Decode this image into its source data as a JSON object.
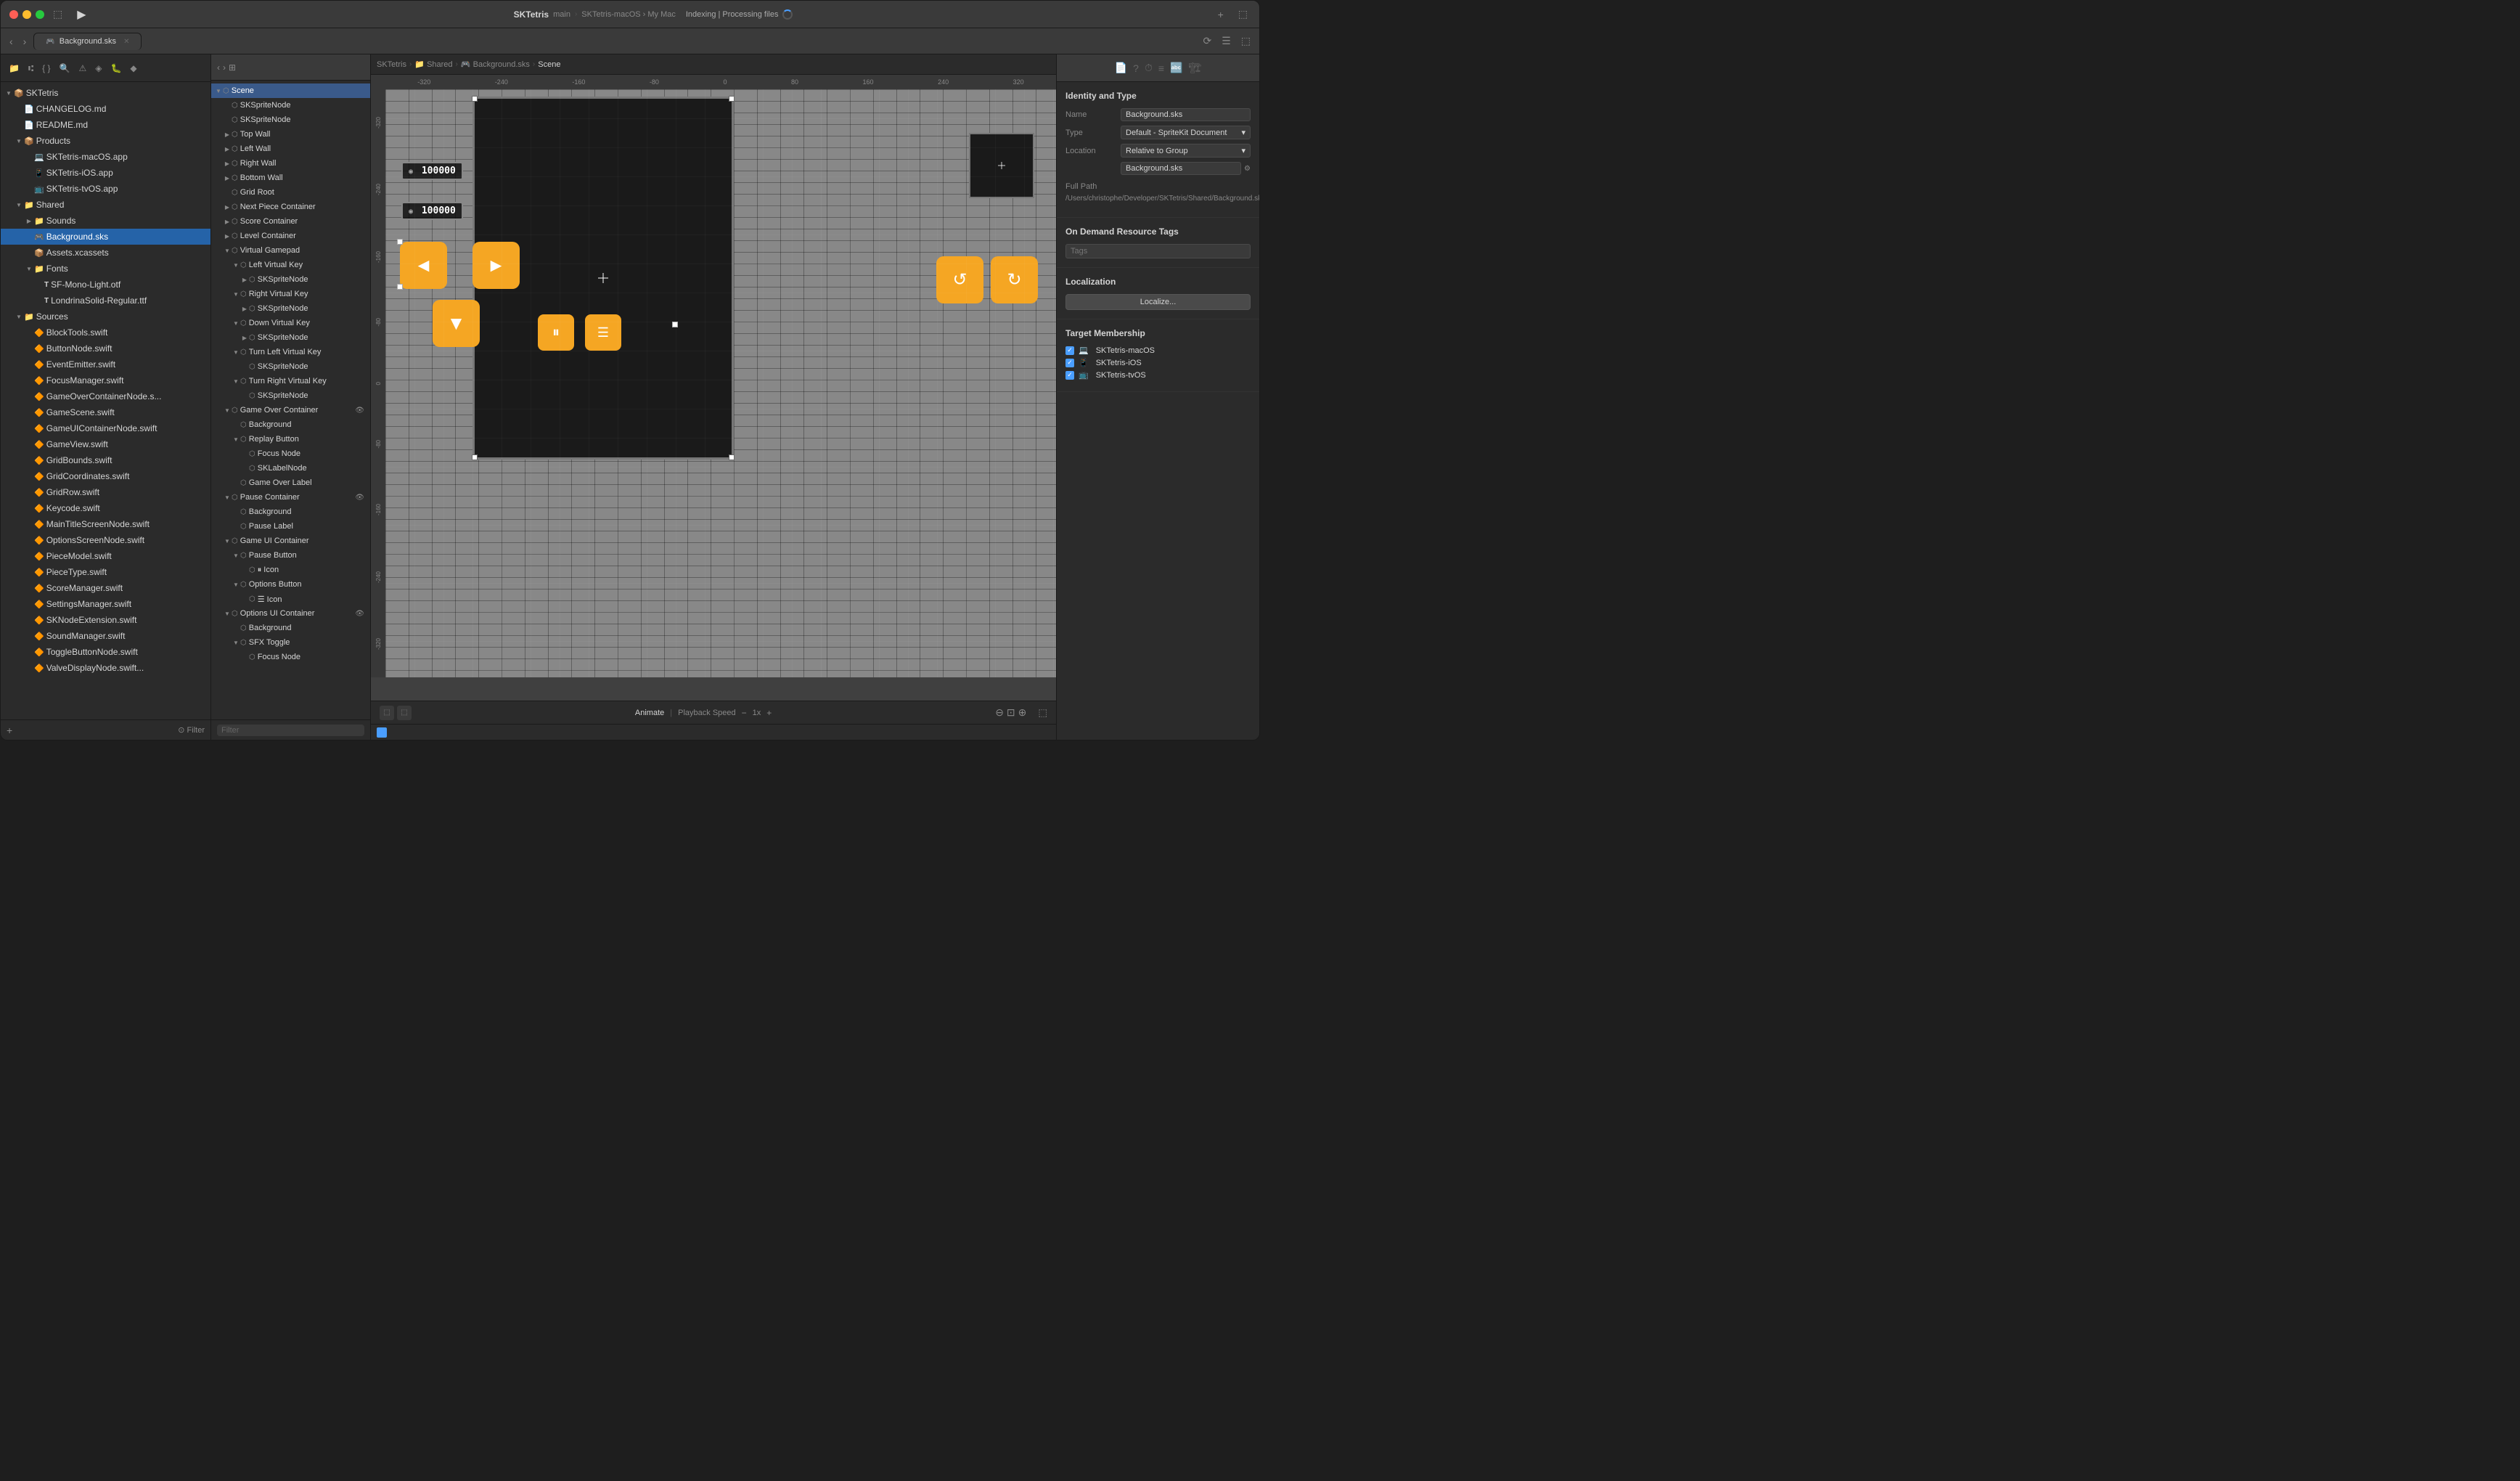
{
  "window": {
    "title": "SKTetris",
    "branch": "main"
  },
  "titleBar": {
    "runBtn": "▶",
    "schemeLabel": "SKTetris",
    "destinationLabel": "SKTetris-macOS › My Mac",
    "statusText": "Indexing | Processing files",
    "sidebarToggle": "⬜",
    "addBtn": "+"
  },
  "tab": {
    "label": "Background.sks",
    "icon": "🎮"
  },
  "breadcrumb": {
    "items": [
      "SKTetris",
      "Shared",
      "Background.sks",
      "Scene"
    ]
  },
  "fileTree": {
    "root": "SKTetris",
    "items": [
      {
        "id": "changelog",
        "label": "CHANGELOG.md",
        "indent": 1,
        "icon": "📄",
        "type": "file"
      },
      {
        "id": "readme",
        "label": "README.md",
        "indent": 1,
        "icon": "📄",
        "type": "file"
      },
      {
        "id": "products",
        "label": "Products",
        "indent": 1,
        "icon": "📦",
        "type": "group",
        "expanded": true
      },
      {
        "id": "app-macos",
        "label": "SKTetris-macOS.app",
        "indent": 2,
        "icon": "💻",
        "type": "file"
      },
      {
        "id": "app-ios",
        "label": "SKTetris-iOS.app",
        "indent": 2,
        "icon": "📱",
        "type": "file"
      },
      {
        "id": "app-tvos",
        "label": "SKTetris-tvOS.app",
        "indent": 2,
        "icon": "📺",
        "type": "file"
      },
      {
        "id": "shared",
        "label": "Shared",
        "indent": 1,
        "icon": "📁",
        "type": "group",
        "expanded": true
      },
      {
        "id": "sounds",
        "label": "Sounds",
        "indent": 2,
        "icon": "📁",
        "type": "group",
        "expanded": false
      },
      {
        "id": "background-sks",
        "label": "Background.sks",
        "indent": 2,
        "icon": "🎮",
        "type": "file",
        "selected": true
      },
      {
        "id": "assets",
        "label": "Assets.xcassets",
        "indent": 2,
        "icon": "📦",
        "type": "file"
      },
      {
        "id": "fonts",
        "label": "Fonts",
        "indent": 2,
        "icon": "📁",
        "type": "group",
        "expanded": true
      },
      {
        "id": "sf-mono",
        "label": "SF-Mono-Light.otf",
        "indent": 3,
        "icon": "T",
        "type": "file"
      },
      {
        "id": "londrina",
        "label": "LondrinaSolid-Regular.ttf",
        "indent": 3,
        "icon": "T",
        "type": "file"
      },
      {
        "id": "sources",
        "label": "Sources",
        "indent": 1,
        "icon": "📁",
        "type": "group",
        "expanded": true
      },
      {
        "id": "blocktools",
        "label": "BlockTools.swift",
        "indent": 2,
        "icon": "🔶",
        "type": "file"
      },
      {
        "id": "buttonnode",
        "label": "ButtonNode.swift",
        "indent": 2,
        "icon": "🔶",
        "type": "file"
      },
      {
        "id": "eventemitter",
        "label": "EventEmitter.swift",
        "indent": 2,
        "icon": "🔶",
        "type": "file"
      },
      {
        "id": "focusmanager",
        "label": "FocusManager.swift",
        "indent": 2,
        "icon": "🔶",
        "type": "file"
      },
      {
        "id": "gameovercontainer",
        "label": "GameOverContainerNode.s...",
        "indent": 2,
        "icon": "🔶",
        "type": "file"
      },
      {
        "id": "gamescene",
        "label": "GameScene.swift",
        "indent": 2,
        "icon": "🔶",
        "type": "file"
      },
      {
        "id": "gameuicontainer",
        "label": "GameUIContainerNode.swift",
        "indent": 2,
        "icon": "🔶",
        "type": "file"
      },
      {
        "id": "gameview",
        "label": "GameView.swift",
        "indent": 2,
        "icon": "🔶",
        "type": "file"
      },
      {
        "id": "gridbounds",
        "label": "GridBounds.swift",
        "indent": 2,
        "icon": "🔶",
        "type": "file"
      },
      {
        "id": "gridcoordinates",
        "label": "GridCoordinates.swift",
        "indent": 2,
        "icon": "🔶",
        "type": "file"
      },
      {
        "id": "gridrow",
        "label": "GridRow.swift",
        "indent": 2,
        "icon": "🔶",
        "type": "file"
      },
      {
        "id": "keycode",
        "label": "Keycode.swift",
        "indent": 2,
        "icon": "🔶",
        "type": "file"
      },
      {
        "id": "maintitlescreen",
        "label": "MainTitleScreenNode.swift",
        "indent": 2,
        "icon": "🔶",
        "type": "file"
      },
      {
        "id": "optionsscreen",
        "label": "OptionsScreenNode.swift",
        "indent": 2,
        "icon": "🔶",
        "type": "file"
      },
      {
        "id": "piecemodel",
        "label": "PieceModel.swift",
        "indent": 2,
        "icon": "🔶",
        "type": "file"
      },
      {
        "id": "piecetype",
        "label": "PieceType.swift",
        "indent": 2,
        "icon": "🔶",
        "type": "file"
      },
      {
        "id": "scoremanager",
        "label": "ScoreManager.swift",
        "indent": 2,
        "icon": "🔶",
        "type": "file"
      },
      {
        "id": "settingsmanager",
        "label": "SettingsManager.swift",
        "indent": 2,
        "icon": "🔶",
        "type": "file"
      },
      {
        "id": "sknodeextension",
        "label": "SKNodeExtension.swift",
        "indent": 2,
        "icon": "🔶",
        "type": "file"
      },
      {
        "id": "soundmanager",
        "label": "SoundManager.swift",
        "indent": 2,
        "icon": "🔶",
        "type": "file"
      },
      {
        "id": "togglebuttonnode",
        "label": "ToggleButtonNode.swift",
        "indent": 2,
        "icon": "🔶",
        "type": "file"
      },
      {
        "id": "valuedisplay",
        "label": "ValveDisplayNode.swift...",
        "indent": 2,
        "icon": "🔶",
        "type": "file"
      }
    ]
  },
  "sceneTree": {
    "items": [
      {
        "id": "scene",
        "label": "Scene",
        "indent": 0,
        "arrow": "▼",
        "icon": "⬡"
      },
      {
        "id": "skspritenode1",
        "label": "SKSpriteNode",
        "indent": 1,
        "arrow": "",
        "icon": "⬡"
      },
      {
        "id": "skspritenode2",
        "label": "SKSpriteNode",
        "indent": 1,
        "arrow": "",
        "icon": "⬡"
      },
      {
        "id": "topwall",
        "label": "Top Wall",
        "indent": 1,
        "arrow": "▶",
        "icon": "⬡"
      },
      {
        "id": "leftwall",
        "label": "Left Wall",
        "indent": 1,
        "arrow": "▶",
        "icon": "⬡"
      },
      {
        "id": "rightwall",
        "label": "Right Wall",
        "indent": 1,
        "arrow": "▶",
        "icon": "⬡"
      },
      {
        "id": "bottomwall",
        "label": "Bottom Wall",
        "indent": 1,
        "arrow": "▶",
        "icon": "⬡"
      },
      {
        "id": "gridroot",
        "label": "Grid Root",
        "indent": 1,
        "arrow": "",
        "icon": "⬡"
      },
      {
        "id": "nextpiece",
        "label": "Next Piece Container",
        "indent": 1,
        "arrow": "▶",
        "icon": "⬡"
      },
      {
        "id": "scorecontainer",
        "label": "Score Container",
        "indent": 1,
        "arrow": "▶",
        "icon": "⬡"
      },
      {
        "id": "levelcontainer",
        "label": "Level Container",
        "indent": 1,
        "arrow": "▶",
        "icon": "⬡"
      },
      {
        "id": "virtualgamepad",
        "label": "Virtual Gamepad",
        "indent": 1,
        "arrow": "▼",
        "icon": "⬡"
      },
      {
        "id": "leftvirtualkey",
        "label": "Left Virtual Key",
        "indent": 2,
        "arrow": "▼",
        "icon": "⬡"
      },
      {
        "id": "sksprite-left",
        "label": "SKSpriteNode",
        "indent": 3,
        "arrow": "▶",
        "icon": "⬡"
      },
      {
        "id": "rightvirtualkey",
        "label": "Right Virtual Key",
        "indent": 2,
        "arrow": "▼",
        "icon": "⬡"
      },
      {
        "id": "sksprite-right",
        "label": "SKSpriteNode",
        "indent": 3,
        "arrow": "▶",
        "icon": "⬡"
      },
      {
        "id": "downvirtualkey",
        "label": "Down Virtual Key",
        "indent": 2,
        "arrow": "▼",
        "icon": "⬡"
      },
      {
        "id": "sksprite-down",
        "label": "SKSpriteNode",
        "indent": 3,
        "arrow": "▶",
        "icon": "⬡"
      },
      {
        "id": "turnleftvirtualkey",
        "label": "Turn Left Virtual Key",
        "indent": 2,
        "arrow": "▼",
        "icon": "⬡"
      },
      {
        "id": "sksprite-turnleft",
        "label": "SKSpriteNode",
        "indent": 3,
        "arrow": "",
        "icon": "⬡"
      },
      {
        "id": "turnrightvirtualkey",
        "label": "Turn Right Virtual Key",
        "indent": 2,
        "arrow": "▼",
        "icon": "⬡"
      },
      {
        "id": "sksprite-turnright",
        "label": "SKSpriteNode",
        "indent": 3,
        "arrow": "",
        "icon": "⬡"
      },
      {
        "id": "gameovercontainer",
        "label": "Game Over Container",
        "indent": 1,
        "arrow": "▼",
        "icon": "⬡",
        "eyeIcon": true
      },
      {
        "id": "background-go",
        "label": "Background",
        "indent": 2,
        "arrow": "",
        "icon": "⬡"
      },
      {
        "id": "replaybutton",
        "label": "Replay Button",
        "indent": 2,
        "arrow": "▼",
        "icon": "⬡"
      },
      {
        "id": "focusnode",
        "label": "Focus Node",
        "indent": 3,
        "arrow": "",
        "icon": "⬡"
      },
      {
        "id": "sklabelnode",
        "label": "SKLabelNode",
        "indent": 3,
        "arrow": "",
        "icon": "⬡"
      },
      {
        "id": "gameoverlabel",
        "label": "Game Over Label",
        "indent": 2,
        "arrow": "",
        "icon": "⬡"
      },
      {
        "id": "pausecontainer",
        "label": "Pause Container",
        "indent": 1,
        "arrow": "▼",
        "icon": "⬡",
        "eyeIcon": true
      },
      {
        "id": "background-p",
        "label": "Background",
        "indent": 2,
        "arrow": "",
        "icon": "⬡"
      },
      {
        "id": "pauselabel",
        "label": "Pause Label",
        "indent": 2,
        "arrow": "",
        "icon": "⬡"
      },
      {
        "id": "gameuicontainer",
        "label": "Game UI Container",
        "indent": 1,
        "arrow": "▼",
        "icon": "⬡"
      },
      {
        "id": "pausebutton",
        "label": "Pause Button",
        "indent": 2,
        "arrow": "▼",
        "icon": "⬡"
      },
      {
        "id": "pause-icon",
        "label": "Icon",
        "indent": 3,
        "arrow": "",
        "icon": "⬡",
        "suffix": "⏸ Icon"
      },
      {
        "id": "optionsbutton",
        "label": "Options Button",
        "indent": 2,
        "arrow": "▼",
        "icon": "⬡"
      },
      {
        "id": "options-icon",
        "label": "Icon",
        "indent": 3,
        "arrow": "",
        "icon": "⬡",
        "suffix": "☰ Icon"
      },
      {
        "id": "optionsuicontainer",
        "label": "Options UI Container",
        "indent": 1,
        "arrow": "▼",
        "icon": "⬡",
        "eyeIcon": true
      },
      {
        "id": "background-opt",
        "label": "Background",
        "indent": 2,
        "arrow": "",
        "icon": "⬡"
      },
      {
        "id": "sfxtoggle",
        "label": "SFX Toggle",
        "indent": 2,
        "arrow": "▼",
        "icon": "⬡"
      },
      {
        "id": "focusnode-opt",
        "label": "Focus Node",
        "indent": 3,
        "arrow": "",
        "icon": "⬡"
      }
    ],
    "filterPlaceholder": "Filter"
  },
  "inspector": {
    "title": "Identity and Type",
    "nameLabel": "Name",
    "nameValue": "Background.sks",
    "typeLabel": "Type",
    "typeValue": "Default - SpriteKit Document",
    "locationLabel": "Location",
    "locationValue": "Relative to Group",
    "filenameLabel": "",
    "filenameValue": "Background.sks",
    "fullPathLabel": "Full Path",
    "fullPathValue": "/Users/christophe/Developer/SKTetris/Shared/Background.sks",
    "onDemandTitle": "On Demand Resource Tags",
    "tagsPlaceholder": "Tags",
    "localizationTitle": "Localization",
    "localizeBtn": "Localize...",
    "targetTitle": "Target Membership",
    "targets": [
      {
        "id": "macos",
        "label": "SKTetris-macOS",
        "icon": "💻",
        "checked": true
      },
      {
        "id": "ios",
        "label": "SKTetris-iOS",
        "icon": "📱",
        "checked": true
      },
      {
        "id": "tvos",
        "label": "SKTetris-tvOS",
        "icon": "📺",
        "checked": true
      }
    ]
  },
  "sceneEditor": {
    "rulerMarks": [
      "-320",
      "-240",
      "-160",
      "-80",
      "0",
      "80",
      "160",
      "240",
      "320"
    ],
    "leftRulerMarks": [
      "-320",
      "-240",
      "-160",
      "-80",
      "0",
      "-80",
      "-160",
      "-240",
      "-320"
    ],
    "animateLabel": "Animate",
    "playbackLabel": "Playback Speed",
    "playbackSpeed": "1x",
    "zoomInBtn": "+",
    "zoomOutBtn": "-",
    "score1": "100000",
    "score2": "100000"
  },
  "bottomBar": {
    "filterPlaceholder": "Filter",
    "addBtnLabel": "+"
  }
}
